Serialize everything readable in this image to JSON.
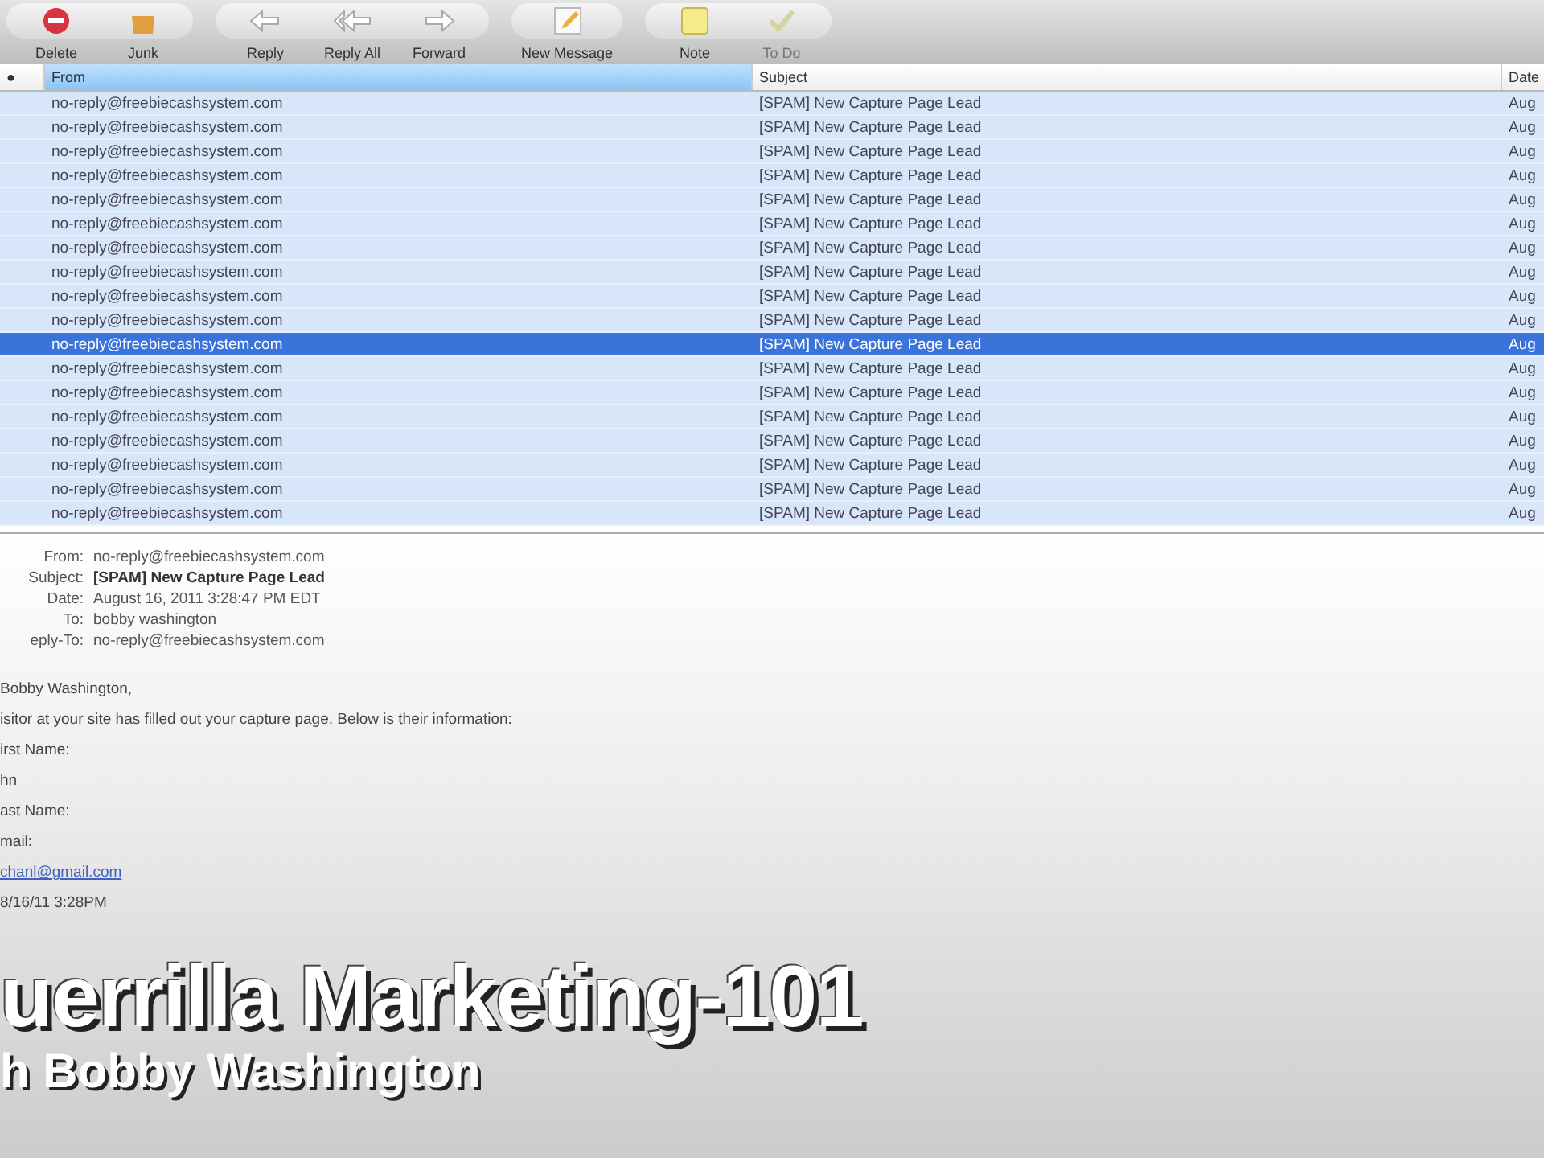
{
  "toolbar": {
    "groups": [
      {
        "buttons": [
          {
            "label": "Delete",
            "disabled": false
          },
          {
            "label": "Junk",
            "disabled": false
          }
        ]
      },
      {
        "buttons": [
          {
            "label": "Reply",
            "disabled": false
          },
          {
            "label": "Reply All",
            "disabled": false
          },
          {
            "label": "Forward",
            "disabled": false
          }
        ]
      },
      {
        "buttons": [
          {
            "label": "New Message",
            "disabled": false
          }
        ]
      },
      {
        "buttons": [
          {
            "label": "Note",
            "disabled": false
          },
          {
            "label": "To Do",
            "disabled": true
          }
        ]
      }
    ]
  },
  "message_list": {
    "columns": [
      {
        "label": "●",
        "selected": false
      },
      {
        "label": "From",
        "selected": true
      },
      {
        "label": "Subject",
        "selected": false
      },
      {
        "label": "Date",
        "selected": false
      }
    ],
    "rows": [
      {
        "from": "no-reply@freebiecashsystem.com",
        "subject": "[SPAM] New Capture Page Lead",
        "date": "Aug",
        "selected": false
      },
      {
        "from": "no-reply@freebiecashsystem.com",
        "subject": "[SPAM] New Capture Page Lead",
        "date": "Aug",
        "selected": false
      },
      {
        "from": "no-reply@freebiecashsystem.com",
        "subject": "[SPAM] New Capture Page Lead",
        "date": "Aug",
        "selected": false
      },
      {
        "from": "no-reply@freebiecashsystem.com",
        "subject": "[SPAM] New Capture Page Lead",
        "date": "Aug",
        "selected": false
      },
      {
        "from": "no-reply@freebiecashsystem.com",
        "subject": "[SPAM] New Capture Page Lead",
        "date": "Aug",
        "selected": false
      },
      {
        "from": "no-reply@freebiecashsystem.com",
        "subject": "[SPAM] New Capture Page Lead",
        "date": "Aug",
        "selected": false
      },
      {
        "from": "no-reply@freebiecashsystem.com",
        "subject": "[SPAM] New Capture Page Lead",
        "date": "Aug",
        "selected": false
      },
      {
        "from": "no-reply@freebiecashsystem.com",
        "subject": "[SPAM] New Capture Page Lead",
        "date": "Aug",
        "selected": false
      },
      {
        "from": "no-reply@freebiecashsystem.com",
        "subject": "[SPAM] New Capture Page Lead",
        "date": "Aug",
        "selected": false
      },
      {
        "from": "no-reply@freebiecashsystem.com",
        "subject": "[SPAM] New Capture Page Lead",
        "date": "Aug",
        "selected": false
      },
      {
        "from": "no-reply@freebiecashsystem.com",
        "subject": "[SPAM] New Capture Page Lead",
        "date": "Aug",
        "selected": true
      },
      {
        "from": "no-reply@freebiecashsystem.com",
        "subject": "[SPAM] New Capture Page Lead",
        "date": "Aug",
        "selected": false
      },
      {
        "from": "no-reply@freebiecashsystem.com",
        "subject": "[SPAM] New Capture Page Lead",
        "date": "Aug",
        "selected": false
      },
      {
        "from": "no-reply@freebiecashsystem.com",
        "subject": "[SPAM] New Capture Page Lead",
        "date": "Aug",
        "selected": false
      },
      {
        "from": "no-reply@freebiecashsystem.com",
        "subject": "[SPAM] New Capture Page Lead",
        "date": "Aug",
        "selected": false
      },
      {
        "from": "no-reply@freebiecashsystem.com",
        "subject": "[SPAM] New Capture Page Lead",
        "date": "Aug",
        "selected": false
      },
      {
        "from": "no-reply@freebiecashsystem.com",
        "subject": "[SPAM] New Capture Page Lead",
        "date": "Aug",
        "selected": false
      },
      {
        "from": "no-reply@freebiecashsystem.com",
        "subject": "[SPAM] New Capture Page Lead",
        "date": "Aug",
        "selected": false
      }
    ]
  },
  "message": {
    "headers": [
      {
        "label": "From:",
        "value": "no-reply@freebiecashsystem.com",
        "kind": "plain"
      },
      {
        "label": "Subject:",
        "value": "[SPAM] New Capture Page Lead",
        "kind": "bold"
      },
      {
        "label": "Date:",
        "value": "August 16, 2011 3:28:47 PM EDT",
        "kind": "plain"
      },
      {
        "label": "To:",
        "value": "bobby washington",
        "kind": "plain"
      },
      {
        "label": "eply-To:",
        "value": "no-reply@freebiecashsystem.com",
        "kind": "plain"
      }
    ],
    "body": [
      {
        "text": "Bobby Washington,",
        "kind": "text"
      },
      {
        "text": "isitor at your site has filled out your capture page. Below is their information:",
        "kind": "text"
      },
      {
        "text": "irst Name:",
        "kind": "text"
      },
      {
        "text": "hn",
        "kind": "text"
      },
      {
        "text": "ast Name:",
        "kind": "text"
      },
      {
        "text": "mail:",
        "kind": "text"
      },
      {
        "text": "chanl@gmail.com",
        "kind": "link"
      },
      {
        "text": "8/16/11 3:28PM",
        "kind": "text"
      }
    ]
  },
  "video_overlay": {
    "title": "uerrilla Marketing-101",
    "subtitle": "h Bobby Washington"
  }
}
